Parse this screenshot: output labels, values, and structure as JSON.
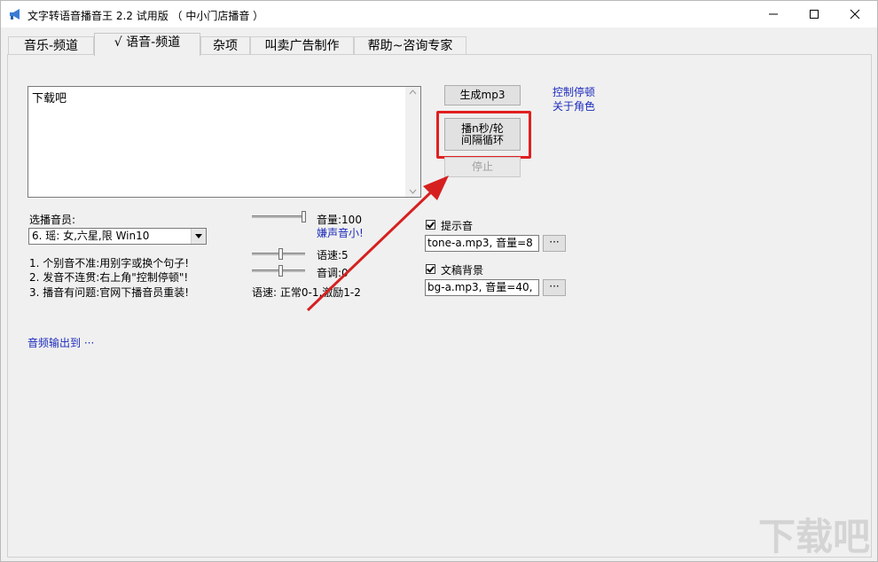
{
  "window": {
    "title": "文字转语音播音王 2.2 试用版 （ 中小门店播音 ）"
  },
  "tabs": [
    {
      "label": "音乐-频道",
      "active": false
    },
    {
      "label": "√ 语音-频道",
      "active": true
    },
    {
      "label": "杂项",
      "active": false
    },
    {
      "label": "叫卖广告制作",
      "active": false
    },
    {
      "label": "帮助~咨询专家",
      "active": false
    }
  ],
  "editor": {
    "text": "下载吧"
  },
  "buttons": {
    "generate_mp3": "生成mp3",
    "play_loop_line1": "播n秒/轮",
    "play_loop_line2": "间隔循环",
    "stop": "停止"
  },
  "links": {
    "control_pause": "控制停顿",
    "about_roles": "关于角色",
    "too_quiet": "嫌声音小!",
    "audio_output": "音频输出到 ···"
  },
  "voice": {
    "label": "选播音员:",
    "selected": "6. 瑶: 女,六星,限 Win10"
  },
  "tips": [
    "1. 个别音不准:用别字或换个句子!",
    "2. 发音不连贯:右上角\"控制停顿\"!",
    "3. 播音有问题:官网下播音员重装!"
  ],
  "sliders": {
    "volume_label": "音量:100",
    "volume_value": 100,
    "speed_label": "语速:5",
    "pitch_label": "音调:0",
    "speed_hint": "语速: 正常0-1,激励1-2"
  },
  "options": {
    "prompt_sound_label": "提示音",
    "prompt_sound_checked": true,
    "prompt_sound_value": "tone-a.mp3, 音量=8",
    "background_label": "文稿背景",
    "background_checked": true,
    "background_value": "bg-a.mp3, 音量=40,",
    "browse_label": "···"
  },
  "watermark": {
    "text": "下载吧"
  },
  "colors": {
    "highlight": "#e02020",
    "link": "#1d2bbb",
    "arrow": "#d62020"
  }
}
